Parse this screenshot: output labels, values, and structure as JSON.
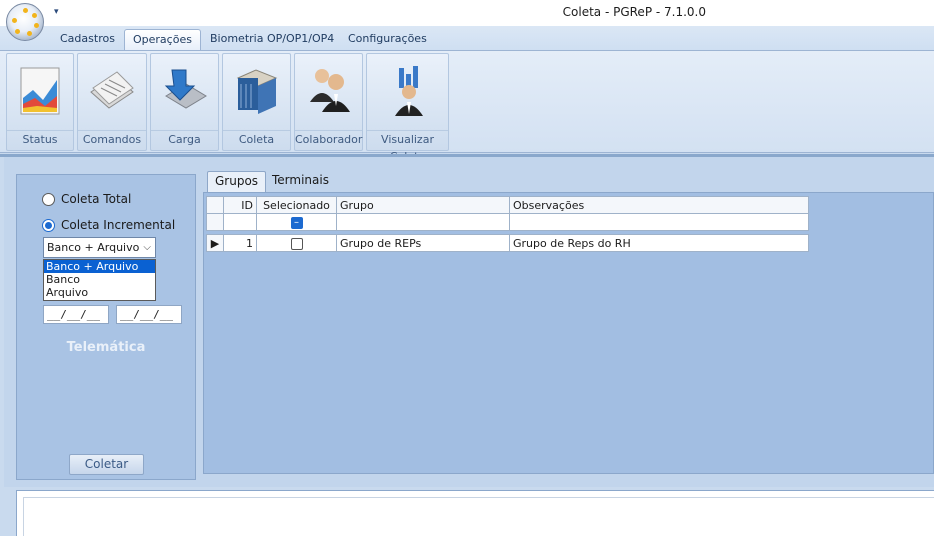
{
  "window": {
    "title": "Coleta - PGReP - 7.1.0.0"
  },
  "quick_access": {
    "arrow": "▾"
  },
  "ribbon_tabs": [
    "Cadastros",
    "Operações",
    "Biometria OP/OP1/OP4",
    "Configurações"
  ],
  "active_ribbon_tab": "Operações",
  "ribbon_buttons": [
    {
      "label": "Status",
      "icon": "status-chart-icon"
    },
    {
      "label": "Comandos",
      "icon": "comandos-documents-icon"
    },
    {
      "label": "Carga",
      "icon": "carga-download-icon"
    },
    {
      "label": "Coleta",
      "icon": "coleta-book-icon"
    },
    {
      "label": "Colaborador",
      "icon": "colaborador-users-icon"
    },
    {
      "label": "Visualizar Coleta",
      "icon": "visualizar-coleta-icon"
    }
  ],
  "left_panel": {
    "radio_total": "Coleta Total",
    "radio_incremental": "Coleta Incremental",
    "selected_radio": "Coleta Incremental",
    "select_value": "Banco + Arquivo",
    "select_options": [
      "Banco + Arquivo",
      "Banco",
      "Arquivo"
    ],
    "date_from": "__/__/__",
    "date_to": "__/__/__",
    "label_telematica": "Telemática",
    "coletar_button": "Coletar"
  },
  "grid_tabs": [
    "Grupos",
    "Terminais"
  ],
  "active_grid_tab": "Grupos",
  "grid": {
    "columns": [
      "ID",
      "Selecionado",
      "Grupo",
      "Observações"
    ],
    "rows": [
      {
        "id": "1",
        "selecionado": false,
        "grupo": "Grupo de REPs",
        "observacoes": "Grupo de Reps do RH"
      }
    ]
  },
  "colors": {
    "accent": "#1c6ad0",
    "panel": "#a2bee2",
    "selection": "#0a61d2"
  }
}
